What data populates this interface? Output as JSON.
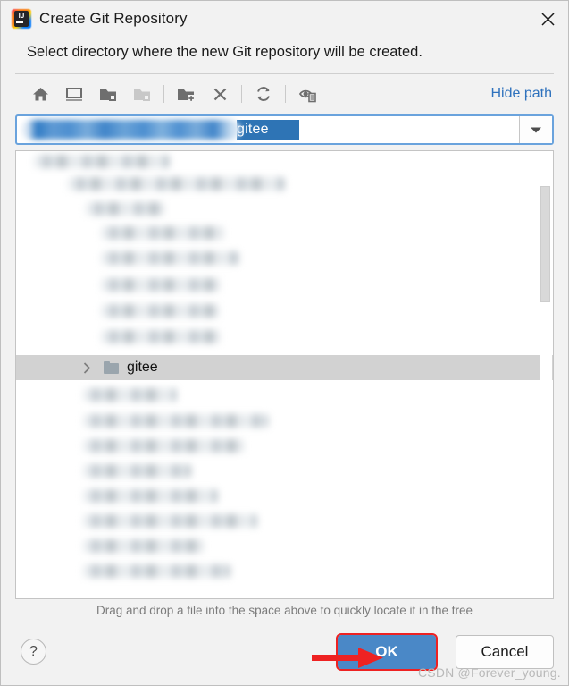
{
  "window": {
    "title": "Create Git Repository",
    "app_icon": "intellij-idea-icon",
    "icon_letters": "IJ",
    "close_label": "×"
  },
  "prompt": {
    "text": "Select directory where the new Git repository will be created."
  },
  "toolbar": {
    "buttons": [
      {
        "name": "home-icon",
        "tooltip": "Home",
        "enabled": true
      },
      {
        "name": "desktop-icon",
        "tooltip": "Desktop",
        "enabled": true
      },
      {
        "name": "project-folder-icon",
        "tooltip": "Project Directory",
        "enabled": true
      },
      {
        "name": "module-folder-icon",
        "tooltip": "Module Directory",
        "enabled": false
      },
      {
        "name": "new-folder-icon",
        "tooltip": "New Folder",
        "enabled": true
      },
      {
        "name": "delete-icon",
        "tooltip": "Delete",
        "enabled": true
      },
      {
        "name": "refresh-icon",
        "tooltip": "Refresh",
        "enabled": true
      },
      {
        "name": "show-hidden-files-icon",
        "tooltip": "Show Hidden Files",
        "enabled": true
      }
    ],
    "hide_path_label": "Hide path"
  },
  "path_field": {
    "redacted": true,
    "visible_value": "gitee",
    "selected": true,
    "dropdown_icon": "chevron-down-icon"
  },
  "tree": {
    "selected_item": {
      "label": "gitee",
      "expand_icon": "chevron-right-icon",
      "folder_icon": "folder-icon"
    },
    "redacted_rows_above": 9,
    "redacted_rows_below": 8,
    "scrollbar_visible": true
  },
  "hint": {
    "text": "Drag and drop a file into the space above to quickly locate it in the tree"
  },
  "buttons": {
    "help_label": "?",
    "ok_label": "OK",
    "cancel_label": "Cancel"
  },
  "annotations": {
    "arrow": "red-arrow-pointing-to-ok",
    "watermark": "CSDN @Forever_young."
  },
  "colors": {
    "accent_blue": "#4a88c7",
    "link_blue": "#2f72bd",
    "selection_blue": "#2e74b5",
    "annotation_red": "#ee2222",
    "dialog_bg": "#f2f2f2"
  }
}
